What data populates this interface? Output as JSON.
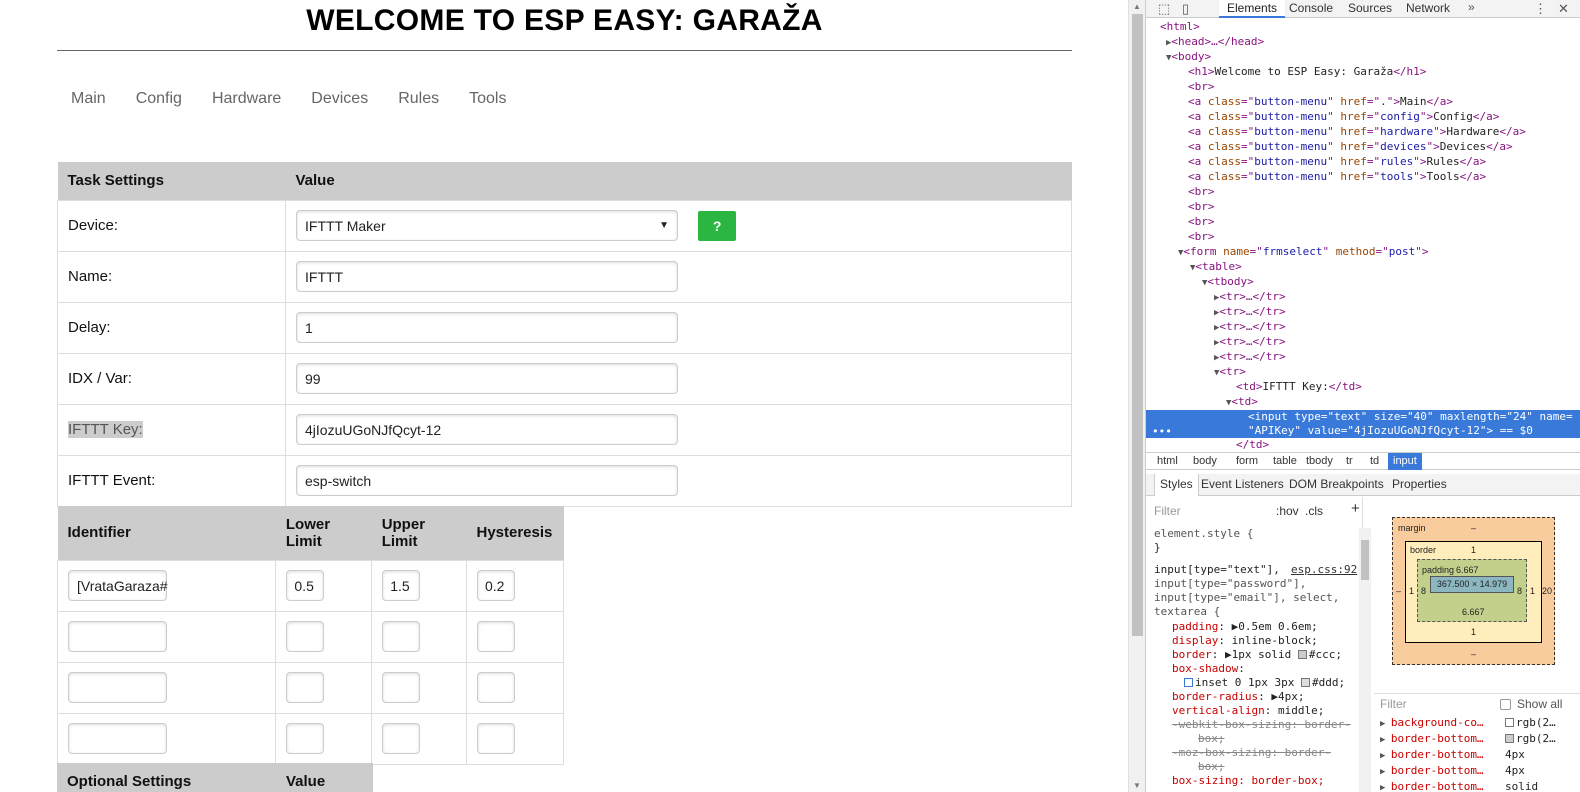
{
  "page": {
    "title": "WELCOME TO ESP EASY: GARAŽA",
    "nav": [
      "Main",
      "Config",
      "Hardware",
      "Devices",
      "Rules",
      "Tools"
    ],
    "task_table": {
      "headers": [
        "Task Settings",
        "Value"
      ],
      "device_label": "Device:",
      "device_value": "IFTTT Maker",
      "help_button": "?",
      "name_label": "Name:",
      "name_value": "IFTTT",
      "delay_label": "Delay:",
      "delay_value": "1",
      "idx_label": "IDX / Var:",
      "idx_value": "99",
      "key_label": "IFTTT Key:",
      "key_value": "4jIozuUGoNJfQcyt-12",
      "event_label": "IFTTT Event:",
      "event_value": "esp-switch"
    },
    "identifier_table": {
      "headers": [
        "Identifier",
        "Lower Limit",
        "Upper Limit",
        "Hysteresis"
      ],
      "rows": [
        [
          "[VrataGaraza#",
          "0.5",
          "1.5",
          "0.2"
        ],
        [
          "",
          "",
          "",
          ""
        ],
        [
          "",
          "",
          "",
          ""
        ],
        [
          "",
          "",
          "",
          ""
        ]
      ]
    },
    "optional_table": {
      "headers": [
        "Optional Settings",
        "Value"
      ]
    }
  },
  "devtools": {
    "tabs": [
      "Elements",
      "Console",
      "Sources",
      "Network"
    ],
    "more": "»",
    "dom": {
      "html_open": "<html>",
      "head": "<head>…</head>",
      "body_open": "<body>",
      "h1_text": "Welcome to ESP Easy: Garaža",
      "menu_links": [
        {
          "href": ".",
          "label": "Main"
        },
        {
          "href": "config",
          "label": "Config"
        },
        {
          "href": "hardware",
          "label": "Hardware"
        },
        {
          "href": "devices",
          "label": "Devices"
        },
        {
          "href": "rules",
          "label": "Rules"
        },
        {
          "href": "tools",
          "label": "Tools"
        }
      ],
      "form_name": "frmselect",
      "form_method": "post",
      "td_text": "IFTTT Key:",
      "input_type": "text",
      "input_size": "40",
      "input_maxlength": "24",
      "input_name": "APIKey",
      "input_value": "4jIozuUGoNJfQcyt-12",
      "selected_marker": "== $0"
    },
    "breadcrumb": [
      "html",
      "body",
      "form",
      "table",
      "tbody",
      "tr",
      "td",
      "input"
    ],
    "sub_tabs": [
      "Styles",
      "Event Listeners",
      "DOM Breakpoints",
      "Properties"
    ],
    "styles": {
      "filter_placeholder": "Filter",
      "hov": ":hov",
      "cls": ".cls",
      "plus": "+",
      "element_style": "element.style {",
      "close_brace": "}",
      "selector_1": "input[type=\"text\"],",
      "source": "esp.css:92",
      "selector_2": "input[type=\"password\"],",
      "selector_3": "input[type=\"email\"], select,",
      "selector_4": "textarea {",
      "rules": [
        {
          "prop": "padding",
          "val": "▶0.5em 0.6em;"
        },
        {
          "prop": "display",
          "val": "inline-block;"
        },
        {
          "prop": "border",
          "val": "▶1px solid ",
          "swatch": "#cccccc",
          "after": "#ccc;"
        },
        {
          "prop": "box-shadow",
          "val": ""
        },
        {
          "prop": "",
          "val": "inset 0 1px 3px ",
          "swatch": "#dddddd",
          "after": "#ddd;"
        },
        {
          "prop": "border-radius",
          "val": "▶4px;"
        },
        {
          "prop": "vertical-align",
          "val": "middle;"
        }
      ],
      "struck_1": "-webkit-box-sizing: border-",
      "struck_1b": "box;",
      "struck_2": "-moz-box-sizing: border-",
      "struck_2b": "box;",
      "last": "box-sizing: border-box;"
    },
    "box_model": {
      "margin_label": "margin",
      "margin_value": "–",
      "border_label": "border",
      "border_value": "1",
      "padding_label": "padding",
      "padding_value": "6.667",
      "content": "367.500 × 14.979",
      "padding_side": "8",
      "border_side": "1",
      "margin_side": "–",
      "margin_right": "20",
      "padding_bottom": "6.667",
      "border_bottom": "1",
      "margin_bottom": "–",
      "filter_placeholder": "Filter",
      "show_all": "Show all"
    },
    "computed": [
      {
        "prop": "background-co…",
        "val": "rgb(2…",
        "swatch": "#ffffff"
      },
      {
        "prop": "border-bottom…",
        "val": "rgb(2…",
        "swatch": "#cccccc"
      },
      {
        "prop": "border-bottom…",
        "val": "4px"
      },
      {
        "prop": "border-bottom…",
        "val": "4px"
      },
      {
        "prop": "border-bottom…",
        "val": "solid"
      }
    ]
  }
}
